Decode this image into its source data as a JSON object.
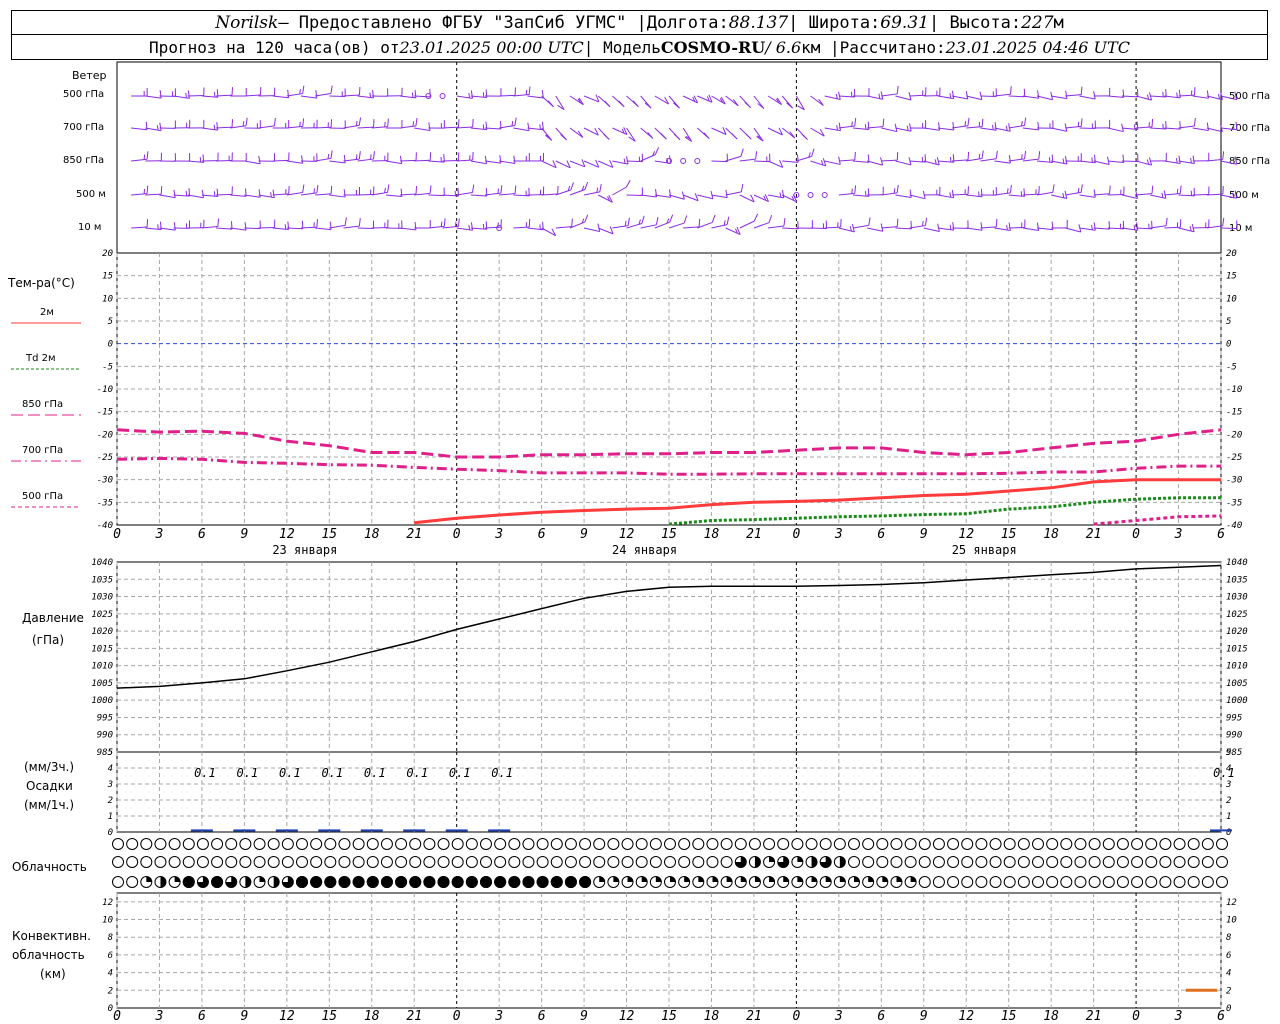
{
  "header": {
    "station": "Norilsk",
    "provider_text": "— Предоставлено ФГБУ \"ЗапСиб УГМС\" |",
    "lon_label": "Долгота:",
    "lon_value": "88.137",
    "lat_label": "| Широта:",
    "lat_value": "69.31",
    "alt_label": "| Высота:",
    "alt_value": "227",
    "alt_unit": "м",
    "forecast_text": "Прогноз на 120 часа(ов) от",
    "forecast_start": "23.01.2025 00:00 UTC",
    "model_label": "| Модель",
    "model_name": "COSMO-RU",
    "model_res": "/ 6.6",
    "model_res_unit": "км |",
    "calc_label": "Рассчитано:",
    "calc_value": "23.01.2025 04:46 UTC"
  },
  "time_axis": {
    "hour_labels": [
      "0",
      "3",
      "6",
      "9",
      "12",
      "15",
      "18",
      "21",
      "0",
      "3",
      "6",
      "9",
      "12",
      "15",
      "18",
      "21",
      "0",
      "3",
      "6",
      "9",
      "12",
      "15",
      "18",
      "21",
      "0",
      "3",
      "6"
    ],
    "day_labels": [
      "23 января",
      "24 января",
      "25 января"
    ]
  },
  "left_labels": {
    "wind": "Ветер",
    "wind_levels": [
      "500 гПа",
      "700 гПа",
      "850 гПа",
      "500 м",
      "10  м"
    ],
    "temp_title": "Тем-ра(°С)",
    "temp_legend": [
      {
        "text": "2м",
        "color": "#ff3b3b",
        "dash": "none"
      },
      {
        "text": "Td  2м",
        "color": "#1a8a1a",
        "dash": "3,2"
      },
      {
        "text": "850 гПа",
        "color": "#e0208a",
        "dash": "12,5"
      },
      {
        "text": "700 гПа",
        "color": "#e0208a",
        "dash": "10,4,2,4"
      },
      {
        "text": "500 гПа",
        "color": "#e0208a",
        "dash": "4,3"
      }
    ],
    "pressure": [
      "Давление",
      "(гПа)"
    ],
    "precip": [
      "(мм/3ч.)",
      "Осадки",
      "(мм/1ч.)"
    ],
    "cloud": "Облачность",
    "conv": [
      "Конвективн.",
      "облачность",
      "(км)"
    ]
  },
  "colors": {
    "wind": "#8a2be2",
    "t2m": "#ff3b3b",
    "td2m": "#1a8a1a",
    "t850": "#e0208a",
    "t700": "#e0208a",
    "t500": "#e0208a",
    "zero_line": "#2b4bd8",
    "pressure": "#000000",
    "precip": "#1f3fb0",
    "conv": "#e07020",
    "grid": "#a8a8a8"
  },
  "chart_data": [
    {
      "type": "line",
      "panel": "temperature",
      "ylim": [
        -40,
        20
      ],
      "yticks": [
        20,
        15,
        10,
        5,
        0,
        -5,
        -10,
        -15,
        -20,
        -25,
        -30,
        -35,
        -40
      ],
      "x_hours": [
        0,
        3,
        6,
        9,
        12,
        15,
        18,
        21,
        24,
        27,
        30,
        33,
        36,
        39,
        42,
        45,
        48,
        51,
        54,
        57,
        60,
        63,
        66,
        69,
        72,
        75,
        78
      ],
      "series": [
        {
          "name": "850 гПа",
          "values": [
            -19,
            -19.5,
            -19.3,
            -19.8,
            -21.5,
            -22.5,
            -24,
            -24,
            -25,
            -25,
            -24.5,
            -24.5,
            -24.3,
            -24.3,
            -24,
            -24,
            -23.5,
            -23,
            -23,
            -24,
            -24.5,
            -24,
            -23,
            -22,
            -21.5,
            -20,
            -19
          ]
        },
        {
          "name": "700 гПа",
          "values": [
            -25.5,
            -25.3,
            -25.5,
            -26.2,
            -26.4,
            -26.7,
            -26.8,
            -27.3,
            -27.7,
            -28,
            -28.5,
            -28.5,
            -28.5,
            -28.8,
            -28.8,
            -28.7,
            -28.7,
            -28.7,
            -28.7,
            -28.7,
            -28.7,
            -28.6,
            -28.3,
            -28.3,
            -27.5,
            -27,
            -27
          ]
        },
        {
          "name": "2м",
          "values": [
            null,
            null,
            null,
            null,
            null,
            null,
            null,
            -39.5,
            -38.5,
            -37.8,
            -37.2,
            -36.8,
            -36.5,
            -36.3,
            -35.5,
            -35,
            -34.8,
            -34.5,
            -34,
            -33.5,
            -33.2,
            -32.5,
            -31.8,
            -30.5,
            -30,
            -30,
            -30
          ]
        },
        {
          "name": "Td  2м",
          "values": [
            null,
            null,
            null,
            null,
            null,
            null,
            null,
            null,
            null,
            null,
            null,
            null,
            null,
            -39.8,
            -39,
            -38.8,
            -38.5,
            -38.2,
            -38,
            -37.7,
            -37.5,
            -36.5,
            -36,
            -35,
            -34.3,
            -34,
            -34
          ]
        },
        {
          "name": "500 гПа",
          "values": [
            null,
            null,
            null,
            null,
            null,
            null,
            null,
            null,
            null,
            null,
            null,
            null,
            null,
            null,
            null,
            null,
            null,
            null,
            null,
            null,
            null,
            null,
            null,
            -39.8,
            -39,
            -38.2,
            -38
          ]
        }
      ]
    },
    {
      "type": "line",
      "panel": "pressure",
      "ylim": [
        985,
        1040
      ],
      "yticks": [
        1040,
        1035,
        1030,
        1025,
        1020,
        1015,
        1010,
        1005,
        1000,
        995,
        990,
        985
      ],
      "x_hours": [
        0,
        3,
        6,
        9,
        12,
        15,
        18,
        21,
        24,
        27,
        30,
        33,
        36,
        39,
        42,
        45,
        48,
        51,
        54,
        57,
        60,
        63,
        66,
        69,
        72,
        75,
        78
      ],
      "series": [
        {
          "name": "Давление",
          "values": [
            1003.5,
            1004,
            1005,
            1006.2,
            1008.5,
            1011,
            1014,
            1017,
            1020.5,
            1023.5,
            1026.5,
            1029.5,
            1031.5,
            1032.7,
            1033,
            1033,
            1033,
            1033.2,
            1033.5,
            1034,
            1034.8,
            1035.5,
            1036.3,
            1037,
            1038,
            1038.5,
            1039
          ]
        }
      ]
    },
    {
      "type": "bar",
      "panel": "precipitation",
      "ylim": [
        0,
        5
      ],
      "yticks": [
        5,
        4,
        3,
        2,
        1,
        0
      ],
      "x_hours": [
        6,
        9,
        12,
        15,
        18,
        21,
        24,
        27,
        78
      ],
      "values": [
        0.1,
        0.1,
        0.1,
        0.1,
        0.1,
        0.1,
        0.1,
        0.1,
        0.1
      ],
      "labels": [
        "0.1",
        "0.1",
        "0.1",
        "0.1",
        "0.1",
        "0.1",
        "0.1",
        "0.1",
        "0.1"
      ]
    },
    {
      "type": "line",
      "panel": "convective_cloud",
      "ylim": [
        0,
        13
      ],
      "yticks": [
        12,
        10,
        8,
        6,
        4,
        2,
        0
      ],
      "segments": [
        {
          "x_start": 75.5,
          "x_end": 78,
          "value": 2
        }
      ]
    }
  ],
  "cloud_rows": {
    "row1": "000000000000000000000000000000000000000000000000000000000000000000000000000000000",
    "row2": "000000000000000000000000000000000000000000003213123200000000000000000000000000000000000000000000000000000000000000000000000000000000003212123232",
    "row3": "001214343212344444444444444444444411111111111111111111111000000000000000000000000000000000000000000000000014444444444444"
  }
}
